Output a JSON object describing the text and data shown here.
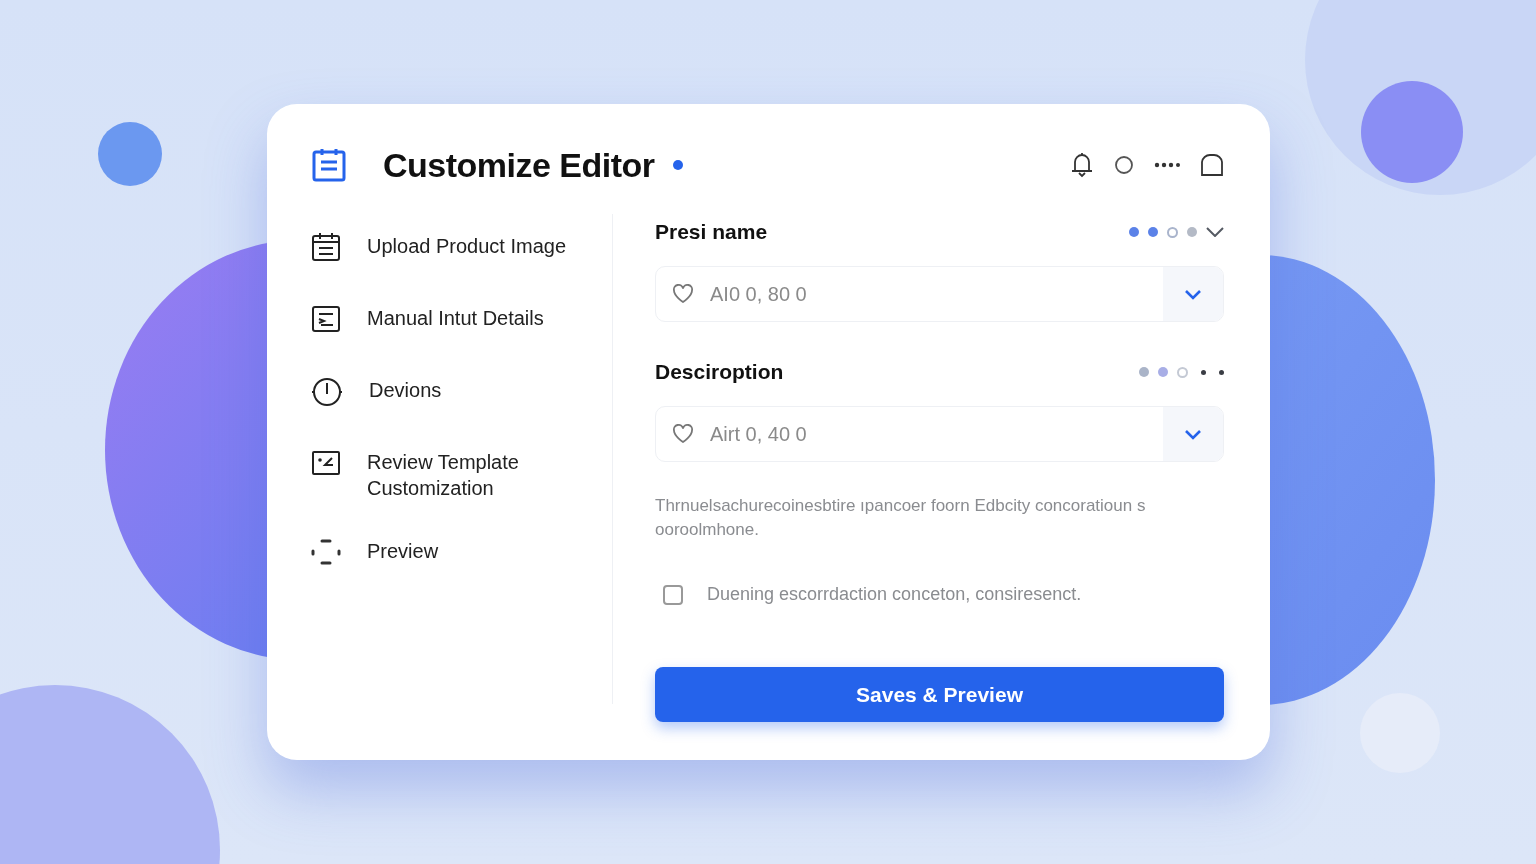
{
  "window": {
    "title": "Customize Editor",
    "status_dot": true
  },
  "toolbar": [
    {
      "kind": "bell"
    },
    {
      "kind": "circle"
    },
    {
      "kind": "more"
    },
    {
      "kind": "tab"
    }
  ],
  "sidebar": {
    "items": [
      {
        "label": "Upload Product Image"
      },
      {
        "label": "Manual Intut Details"
      },
      {
        "label": "Devions"
      },
      {
        "label": "Review Template Customization"
      },
      {
        "label": "Preview"
      }
    ]
  },
  "fields": [
    {
      "label": "Presi name",
      "placeholder": "AI0 0, 80 0",
      "indicators": [
        {
          "kind": "dot",
          "color": "#5b82e8"
        },
        {
          "kind": "dot",
          "color": "#5b82e8"
        },
        {
          "kind": "ring",
          "color": "#a9b4cc"
        },
        {
          "kind": "dot",
          "color": "#b4bac6"
        },
        {
          "kind": "chevron",
          "color": "#555a63"
        }
      ]
    },
    {
      "label": "Desciroption",
      "placeholder": "Airt 0, 40 0",
      "indicators": [
        {
          "kind": "dot",
          "color": "#aab4c8"
        },
        {
          "kind": "dot",
          "color": "#a8aee6"
        },
        {
          "kind": "ring",
          "color": "#c4c9d4"
        },
        {
          "kind": "small",
          "color": "#3a3d44"
        },
        {
          "kind": "small",
          "color": "#3a3d44"
        }
      ]
    }
  ],
  "help_text": "Thrnuelsachurecoinesbtire ıpancoer foorn Edbcity concoratioun s ooroolmhone.",
  "checkbox": {
    "label": "Duening escorrdaction conceton, consiresenct.",
    "checked": false
  },
  "primary_button": "Saves & Preview"
}
